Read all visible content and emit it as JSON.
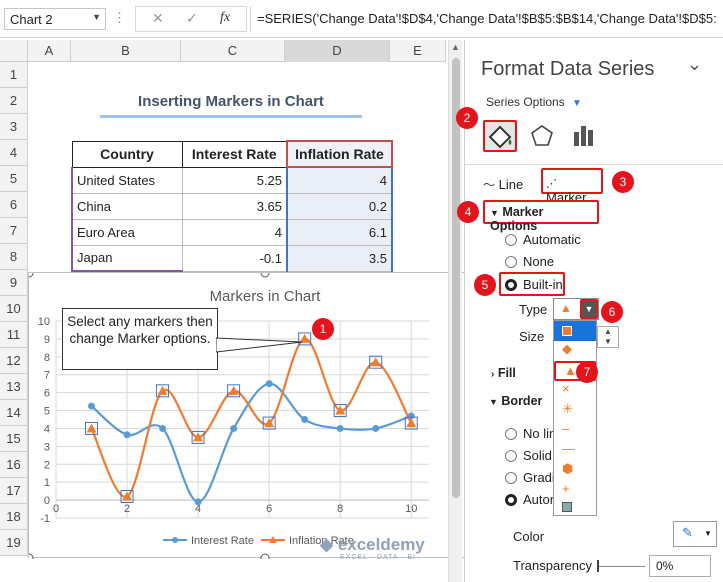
{
  "formula_bar": {
    "name_box": "Chart 2",
    "cancel_symbol": "✕",
    "enter_symbol": "✓",
    "fx_label": "fx",
    "formula": "=SERIES('Change Data'!$D$4,'Change Data'!$B$5:$B$14,'Change Data'!$D$5:"
  },
  "columns": [
    "A",
    "B",
    "C",
    "D",
    "E"
  ],
  "rows": [
    "1",
    "2",
    "3",
    "4",
    "5",
    "6",
    "7",
    "8",
    "9",
    "10",
    "11",
    "12",
    "13",
    "14",
    "15",
    "16",
    "17",
    "18",
    "19"
  ],
  "sheet": {
    "title": "Inserting Markers in Chart",
    "headers": [
      "Country",
      "Interest Rate",
      "Inflation Rate"
    ],
    "rows": [
      [
        "United States",
        "5.25",
        "4"
      ],
      [
        "China",
        "3.65",
        "0.2"
      ],
      [
        "Euro Area",
        "4",
        "6.1"
      ],
      [
        "Japan",
        "-0.1",
        "3.5"
      ]
    ]
  },
  "chart_data": {
    "type": "line",
    "title": "Markers in Chart",
    "x": [
      1,
      2,
      3,
      4,
      5,
      6,
      7,
      8,
      9,
      10
    ],
    "series": [
      {
        "name": "Interest Rate",
        "values": [
          5.25,
          3.65,
          4,
          -0.1,
          4,
          6.5,
          4.5,
          4,
          4,
          4.7
        ],
        "color": "#5b9bd5"
      },
      {
        "name": "Inflation Rate",
        "values": [
          4,
          0.2,
          6.1,
          3.5,
          6.1,
          4.3,
          9,
          5,
          7.7,
          4.3
        ],
        "color": "#ed7d31"
      }
    ],
    "xlim": [
      0,
      10.5
    ],
    "ylim": [
      -1,
      10
    ],
    "xticks": [
      "0",
      "2",
      "4",
      "6",
      "8",
      "10"
    ],
    "yticks": [
      "-1",
      "0",
      "1",
      "2",
      "3",
      "4",
      "5",
      "6",
      "7",
      "8",
      "9",
      "10"
    ],
    "grid": true,
    "legend_position": "bottom"
  },
  "callout": {
    "text": "Select any markers then change Marker options.",
    "badge": "1"
  },
  "pane": {
    "title": "Format Data Series",
    "collapse_symbol": "⌄",
    "series_options": "Series Options",
    "line_tab": "Line",
    "marker_tab": "Marker",
    "marker_options": "Marker Options",
    "automatic": "Automatic",
    "none": "None",
    "built_in": "Built-in",
    "type_label": "Type",
    "size_label": "Size",
    "fill_label": "Fill",
    "border_label": "Border",
    "border_options": [
      "No lin",
      "Solid l",
      "Gradie",
      "Auton"
    ],
    "color_label": "Color",
    "transparency_label": "Transparency",
    "transparency_value": "0%",
    "badges": [
      "2",
      "3",
      "4",
      "5",
      "6",
      "7"
    ]
  },
  "watermark": {
    "brand": "exceldemy",
    "tagline": "EXCEL · DATA · BI"
  },
  "colors": {
    "accent_red": "#e3141b",
    "interest": "#5b9bd5",
    "inflation": "#ed7d31",
    "selection_blue": "#0078d4"
  }
}
